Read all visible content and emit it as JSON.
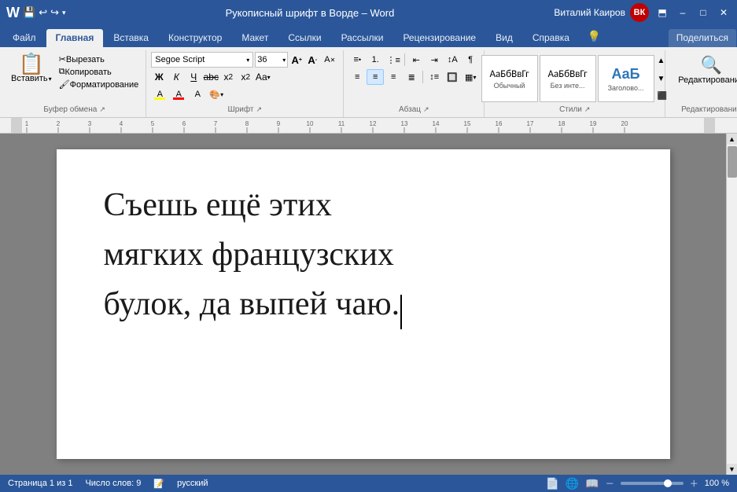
{
  "titlebar": {
    "title": "Рукописный шрифт в Ворде  –  Word",
    "user": "Виталий Каиров",
    "min_label": "–",
    "max_label": "□",
    "close_label": "✕",
    "restore_label": "❐"
  },
  "tabs": [
    {
      "label": "Файл",
      "active": false
    },
    {
      "label": "Главная",
      "active": true
    },
    {
      "label": "Вставка",
      "active": false
    },
    {
      "label": "Конструктор",
      "active": false
    },
    {
      "label": "Макет",
      "active": false
    },
    {
      "label": "Ссылки",
      "active": false
    },
    {
      "label": "Рассылки",
      "active": false
    },
    {
      "label": "Рецензирование",
      "active": false
    },
    {
      "label": "Вид",
      "active": false
    },
    {
      "label": "Справка",
      "active": false
    },
    {
      "label": "Помощник",
      "active": false
    }
  ],
  "ribbon": {
    "clipboard_label": "Буфер обмена",
    "font_label": "Шрифт",
    "paragraph_label": "Абзац",
    "styles_label": "Стили",
    "editing_label": "Редактирование",
    "paste_label": "Вставить",
    "font_name": "Segoe Script",
    "font_size": "36",
    "style_normal": "Обычный",
    "style_no_spacing": "Без инте...",
    "style_heading": "Заголово...",
    "editing_btn_label": "Редактирование"
  },
  "document": {
    "text_line1": "Съешь ещё этих",
    "text_line2": "мягких французских",
    "text_line3": "булок, да выпей чаю."
  },
  "statusbar": {
    "page": "Страница 1 из 1",
    "words": "Число слов: 9",
    "language": "русский",
    "zoom": "100 %"
  },
  "quickaccess": {
    "save": "💾",
    "undo": "↩",
    "redo": "↪",
    "dropdown": "▾"
  }
}
